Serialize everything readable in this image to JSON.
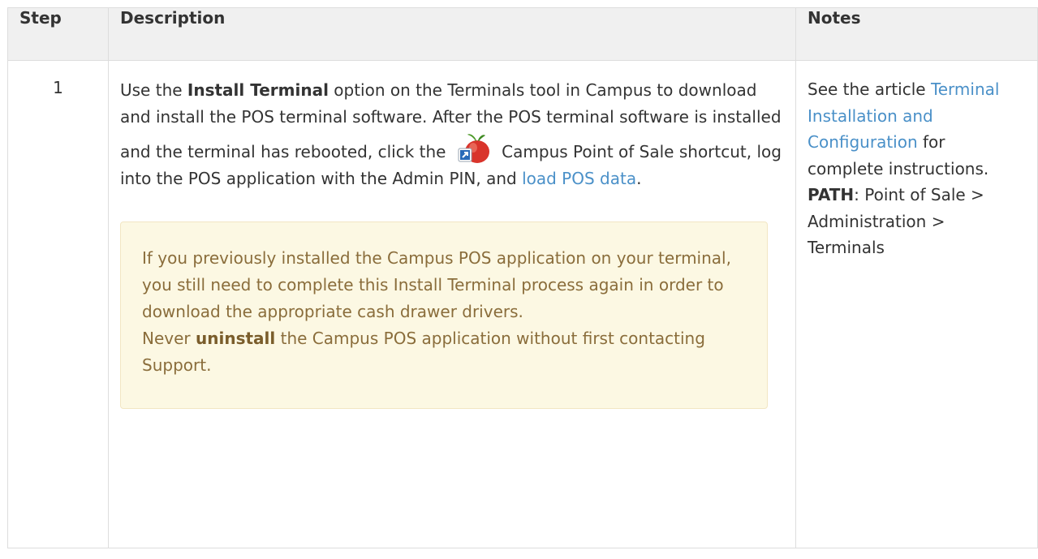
{
  "table": {
    "headers": {
      "step": "Step",
      "description": "Description",
      "notes": "Notes"
    },
    "row1": {
      "step": "1",
      "desc": {
        "p1": "Use the ",
        "p1_bold": "Install Terminal",
        "p2": " option on the Terminals tool in Campus to download and install the POS terminal software. After the POS terminal software is installed and the terminal has rebooted, click the ",
        "icon_name": "campus-pos-apple-shortcut-icon",
        "p3": " Campus Point of Sale shortcut, log into the POS application with the Admin PIN, and ",
        "link_text": "load POS data",
        "p4": "."
      },
      "alert": {
        "line1": "If you previously installed the Campus POS application on your terminal, you still need to complete this Install Terminal process again in order to download the appropriate cash drawer drivers.",
        "line2_pre": "Never ",
        "line2_bold": "uninstall",
        "line2_post": " the Campus POS application without first contacting Support."
      },
      "notes": {
        "pre": "See the article ",
        "link_text": "Terminal Installation and Configuration",
        "post": " for complete instructions.",
        "path_label": "PATH",
        "path_value": ": Point of Sale > Administration > Terminals"
      }
    }
  },
  "colors": {
    "link": "#4a90c8",
    "alert_bg": "#fcf8e3",
    "alert_text": "#8a6d3b",
    "header_bg": "#f0f0f0"
  }
}
